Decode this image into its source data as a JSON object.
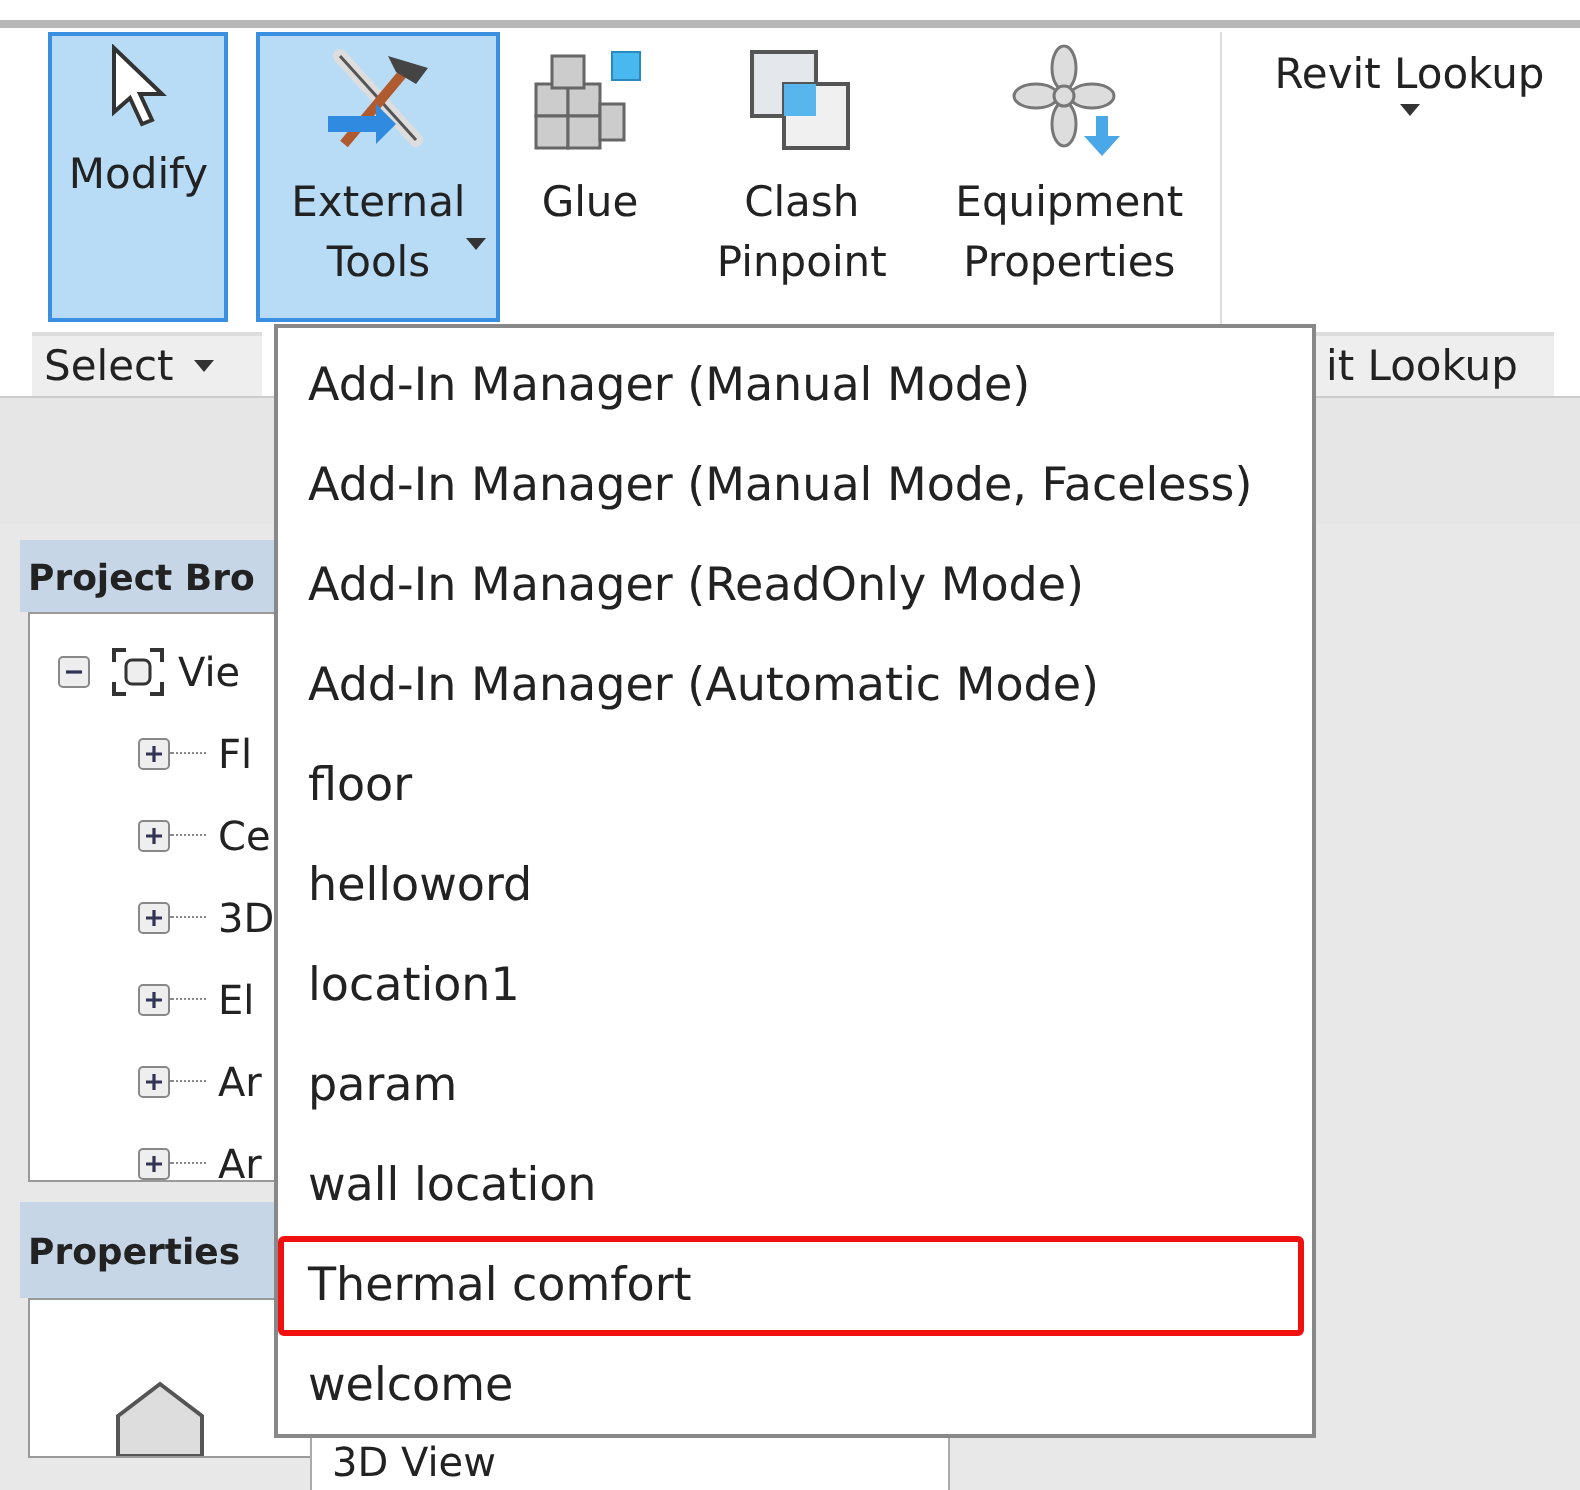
{
  "ribbon": {
    "buttons": [
      {
        "label": "Modify",
        "kind": "cursor",
        "selected": true,
        "dropdown": false
      },
      {
        "label": "External Tools",
        "kind": "tools",
        "selected": true,
        "dropdown": true
      },
      {
        "label": "Glue",
        "kind": "cubes",
        "selected": false,
        "dropdown": false
      },
      {
        "label": "Clash Pinpoint",
        "kind": "squares",
        "selected": false,
        "dropdown": false
      },
      {
        "label": "Equipment Properties",
        "kind": "fan",
        "selected": false,
        "dropdown": false
      }
    ],
    "lookup_button": {
      "label": "Revit Lookup",
      "dropdown": true
    },
    "panel_labels": [
      {
        "label": "Select",
        "dropdown": true
      },
      {
        "label": "it Lookup",
        "dropdown": false
      }
    ]
  },
  "dropdown_menu": {
    "items": [
      {
        "label": "Add-In Manager (Manual Mode)",
        "selected": false
      },
      {
        "label": "Add-In Manager (Manual Mode, Faceless)",
        "selected": false
      },
      {
        "label": "Add-In Manager (ReadOnly Mode)",
        "selected": false
      },
      {
        "label": "Add-In Manager (Automatic Mode)",
        "selected": false
      },
      {
        "label": "floor",
        "selected": false
      },
      {
        "label": "helloword",
        "selected": false
      },
      {
        "label": "location1",
        "selected": false
      },
      {
        "label": "param",
        "selected": false
      },
      {
        "label": "wall location",
        "selected": false
      },
      {
        "label": "Thermal comfort",
        "selected": true
      },
      {
        "label": "welcome",
        "selected": false
      }
    ]
  },
  "project_browser": {
    "title": "Project Bro",
    "tree": [
      {
        "label": "Vie",
        "expanded": true,
        "children": [
          {
            "label": "Fl",
            "expanded": false
          },
          {
            "label": "Ce",
            "expanded": false
          },
          {
            "label": "3D",
            "expanded": false
          },
          {
            "label": "El",
            "expanded": false
          },
          {
            "label": "Ar",
            "expanded": false
          },
          {
            "label": "Ar",
            "expanded": false
          }
        ]
      }
    ]
  },
  "properties": {
    "title": "Properties",
    "type_selector": "3D View"
  }
}
